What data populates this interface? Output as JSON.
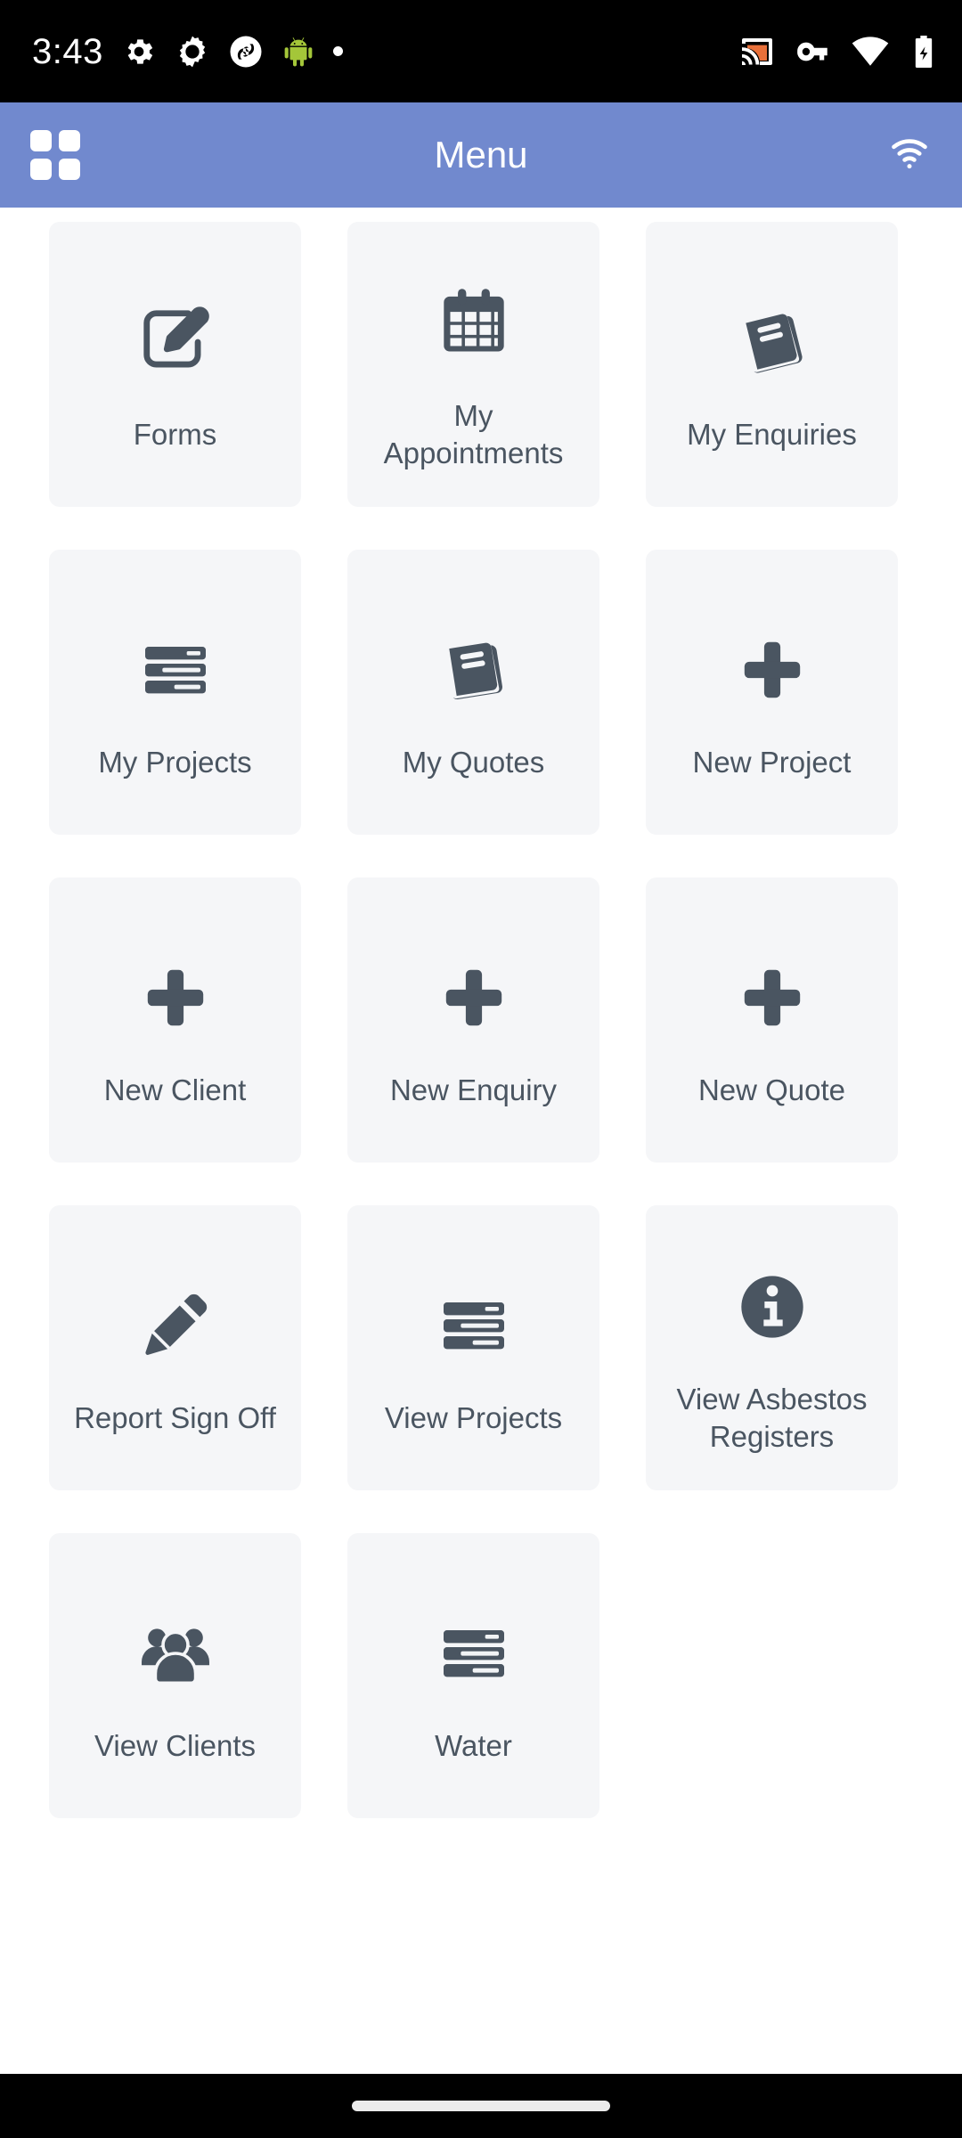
{
  "status_bar": {
    "time": "3:43",
    "left_icons": [
      "gear-icon",
      "gear-cog-icon",
      "shutter-icon",
      "android-robot-icon",
      "dot-icon"
    ],
    "right_icons": [
      "cast-icon",
      "vpn-key-icon",
      "wifi-icon",
      "battery-charging-icon"
    ],
    "colors": {
      "background": "#000000",
      "foreground": "#ffffff",
      "cast_accent": "#e8703a"
    }
  },
  "app_bar": {
    "title": "Menu",
    "left_icon": "grid-menu-icon",
    "right_icon": "wifi-icon",
    "colors": {
      "background": "#7189ce",
      "foreground": "#ffffff"
    }
  },
  "theme": {
    "tile_background": "#f5f6f8",
    "icon_color": "#4a5561",
    "label_color": "#4a5561",
    "page_background": "#ffffff",
    "nav_background": "#000000"
  },
  "menu": {
    "tiles": [
      {
        "label": "Forms",
        "icon": "edit-square-pencil-icon"
      },
      {
        "label": "My\nAppointments",
        "icon": "calendar-icon"
      },
      {
        "label": "My Enquiries",
        "icon": "book-icon"
      },
      {
        "label": "My Projects",
        "icon": "stacked-bars-icon"
      },
      {
        "label": "My Quotes",
        "icon": "book-icon"
      },
      {
        "label": "New Project",
        "icon": "plus-icon"
      },
      {
        "label": "New Client",
        "icon": "plus-icon"
      },
      {
        "label": "New Enquiry",
        "icon": "plus-icon"
      },
      {
        "label": "New Quote",
        "icon": "plus-icon"
      },
      {
        "label": "Report Sign Off",
        "icon": "pencil-icon"
      },
      {
        "label": "View Projects",
        "icon": "stacked-bars-icon"
      },
      {
        "label": "View Asbestos\nRegisters",
        "icon": "info-circle-icon"
      },
      {
        "label": "View Clients",
        "icon": "people-group-icon"
      },
      {
        "label": "Water",
        "icon": "stacked-bars-icon"
      }
    ]
  },
  "nav_bar": {
    "gesture_pill": "home-gesture-pill"
  }
}
